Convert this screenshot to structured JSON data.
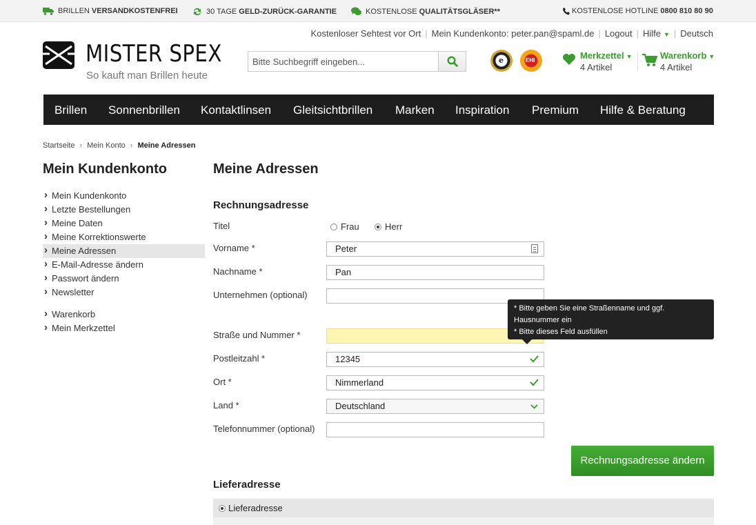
{
  "promos": [
    {
      "pre": "BRILLEN ",
      "bold": "VERSANDKOSTENFREI",
      "icon": "truck-icon"
    },
    {
      "pre": "30 TAGE ",
      "bold": "GELD-ZURÜCK-GARANTIE",
      "icon": "refresh-icon"
    },
    {
      "pre": "KOSTENLOSE ",
      "bold": "QUALITÄTSGLÄSER**",
      "icon": "chat-icon"
    },
    {
      "pre": "KOSTENLOSE HOTLINE ",
      "bold": "0800 810 80 90",
      "icon": "phone-icon"
    }
  ],
  "utility": {
    "sehtest": "Kostenloser Sehtest vor Ort",
    "account": "Mein Kundenkonto: peter.pan@spaml.de",
    "logout": "Logout",
    "help": "Hilfe",
    "language": "Deutsch"
  },
  "logo": {
    "name": "MISTER SPEX",
    "tagline": "So kauft man Brillen heute"
  },
  "search": {
    "placeholder": "Bitte Suchbegriff eingeben..."
  },
  "seals": {
    "trusted": "e",
    "ehi": "EHI"
  },
  "wishlist": {
    "label": "Merkzettel",
    "count": "4 Artikel"
  },
  "cart": {
    "label": "Warenkorb",
    "count": "4 Artikel"
  },
  "nav": [
    "Brillen",
    "Sonnenbrillen",
    "Kontaktlinsen",
    "Gleitsichtbrillen",
    "Marken",
    "Inspiration",
    "Premium",
    "Hilfe & Beratung"
  ],
  "breadcrumb": [
    "Startseite",
    "Mein Konto",
    "Meine Adressen"
  ],
  "sidebar": {
    "title": "Mein Kundenkonto",
    "items": [
      "Mein Kundenkonto",
      "Letzte Bestellungen",
      "Meine Daten",
      "Meine Korrektionswerte",
      "Meine Adressen",
      "E-Mail-Adresse ändern",
      "Passwort ändern",
      "Newsletter"
    ],
    "items2": [
      "Warenkorb",
      "Mein Merkzettel"
    ]
  },
  "page": {
    "title": "Meine Adressen",
    "billing_title": "Rechnungsadresse",
    "shipping_title": "Lieferadresse"
  },
  "form": {
    "title_label": "Titel",
    "title_options": [
      "Frau",
      "Herr"
    ],
    "firstname_label": "Vorname *",
    "firstname_value": "Peter",
    "lastname_label": "Nachname *",
    "lastname_value": "Pan",
    "company_label": "Unternehmen (optional)",
    "company_value": "",
    "street_label": "Straße und Nummer *",
    "street_value": "",
    "zip_label": "Postleitzahl *",
    "zip_value": "12345",
    "city_label": "Ort *",
    "city_value": "Nimmerland",
    "country_label": "Land *",
    "country_value": "Deutschland",
    "phone_label": "Telefonnummer (optional)",
    "phone_value": "",
    "submit": "Rechnungsadresse ändern"
  },
  "tooltip": {
    "line1": "* Bitte geben Sie eine Straßenname und ggf.",
    "line2": "Hausnummer ein",
    "line3": "* Bitte dieses Feld ausfüllen"
  },
  "shipping_option": "Lieferadresse",
  "colors": {
    "accent": "#3c9b2f",
    "nav_bg": "#1e1e1e"
  }
}
